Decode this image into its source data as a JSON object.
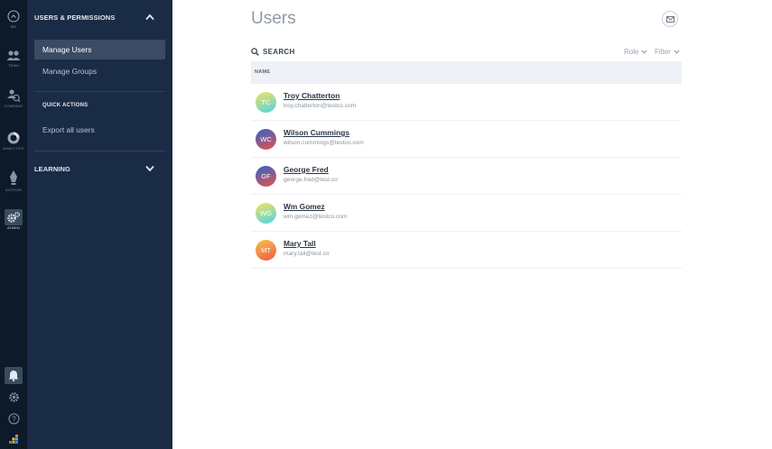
{
  "rail": {
    "items": [
      {
        "label": "ME",
        "icon": "user-circle-icon"
      },
      {
        "label": "TEAM",
        "icon": "team-icon"
      },
      {
        "label": "COMPANY",
        "icon": "company-icon"
      },
      {
        "label": "ANALYTICS",
        "icon": "analytics-icon"
      },
      {
        "label": "AUTHOR",
        "icon": "author-icon"
      },
      {
        "label": "ADMIN",
        "icon": "gear-icon"
      }
    ],
    "bottom": [
      {
        "icon": "bell-icon"
      },
      {
        "icon": "settings-icon"
      },
      {
        "icon": "help-icon"
      },
      {
        "icon": "apps-icon"
      }
    ]
  },
  "sidebar": {
    "sections": [
      {
        "title": "USERS & PERMISSIONS",
        "expanded": true
      },
      {
        "title": "LEARNING",
        "expanded": false
      }
    ],
    "items": [
      {
        "label": "Manage Users",
        "active": true
      },
      {
        "label": "Manage Groups",
        "active": false
      }
    ],
    "quick_actions": {
      "title": "QUICK ACTIONS",
      "items": [
        {
          "label": "Export all users"
        }
      ]
    }
  },
  "main": {
    "title": "Users",
    "search_label": "SEARCH",
    "role_label": "Role",
    "filter_label": "Filter",
    "column_name": "NAME",
    "users": [
      {
        "initials": "TC",
        "name": "Troy Chatterton",
        "email": "troy.chatterton@testco.com",
        "color_top": "#f4e45c",
        "color_bottom": "#4fd3e8"
      },
      {
        "initials": "WC",
        "name": "Wilson Cummings",
        "email": "wilson.cummings@testco.com",
        "color_top": "#2d63c8",
        "color_bottom": "#e8524a"
      },
      {
        "initials": "GF",
        "name": "George Fred",
        "email": "george.fred@test.co",
        "color_top": "#2d63c8",
        "color_bottom": "#e8524a"
      },
      {
        "initials": "WG",
        "name": "Wm Gomez",
        "email": "wm.gomez@testco.com",
        "color_top": "#f4e45c",
        "color_bottom": "#4fd3e8"
      },
      {
        "initials": "MT",
        "name": "Mary Tall",
        "email": "mary.tall@test.co",
        "color_top": "#f5c44a",
        "color_bottom": "#f0584a"
      }
    ]
  }
}
